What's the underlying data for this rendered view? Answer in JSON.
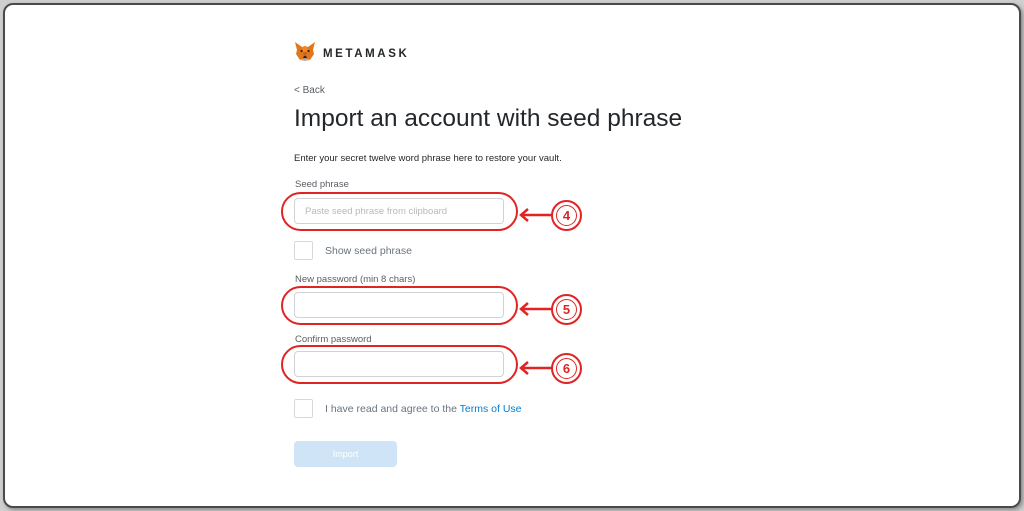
{
  "brand": {
    "name": "METAMASK",
    "logo_icon": "metamask-fox-icon"
  },
  "nav": {
    "back_label": "< Back"
  },
  "page": {
    "title": "Import an account with seed phrase",
    "description": "Enter your secret twelve word phrase here to restore your vault."
  },
  "form": {
    "seed_label": "Seed phrase",
    "seed_placeholder": "Paste seed phrase from clipboard",
    "show_seed_label": "Show seed phrase",
    "new_password_label": "New password (min 8 chars)",
    "confirm_password_label": "Confirm password",
    "terms_prefix": "I have read and agree to the ",
    "terms_link": "Terms of Use",
    "import_label": "Import"
  },
  "annotations": {
    "markers": [
      "4",
      "5",
      "6"
    ],
    "color": "#e02424"
  },
  "colors": {
    "link": "#037dd6",
    "button_disabled": "#cfe5f7"
  }
}
